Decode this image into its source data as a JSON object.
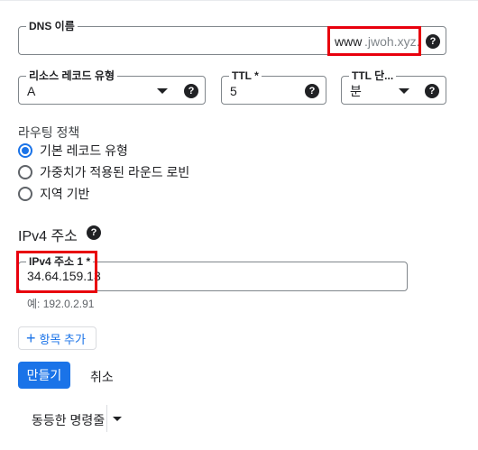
{
  "dns_name": {
    "label": "DNS 이름",
    "prefix": "www",
    "suffix": ".jwoh.xyz."
  },
  "record_type": {
    "label": "리소스 레코드 유형",
    "value": "A"
  },
  "ttl": {
    "label": "TTL *",
    "value": "5"
  },
  "ttl_unit": {
    "label": "TTL 단...",
    "value": "분"
  },
  "routing": {
    "label": "라우팅 정책",
    "options": [
      "기본 레코드 유형",
      "가중치가 적용된 라운드 로빈",
      "지역 기반"
    ],
    "selected_index": 0
  },
  "ipv4": {
    "heading": "IPv4 주소",
    "field_label": "IPv4 주소 1 *",
    "value": "34.64.159.13",
    "hint": "예: 192.0.2.91"
  },
  "add_item_label": "항목 추가",
  "create_label": "만들기",
  "cancel_label": "취소",
  "equivalent_command_label": "동등한 명령줄",
  "colors": {
    "accent": "#1a73e8",
    "highlight": "#e8000d"
  },
  "icons": {
    "help": "help-circle-icon",
    "dropdown": "caret-down-icon",
    "add": "plus-icon"
  }
}
